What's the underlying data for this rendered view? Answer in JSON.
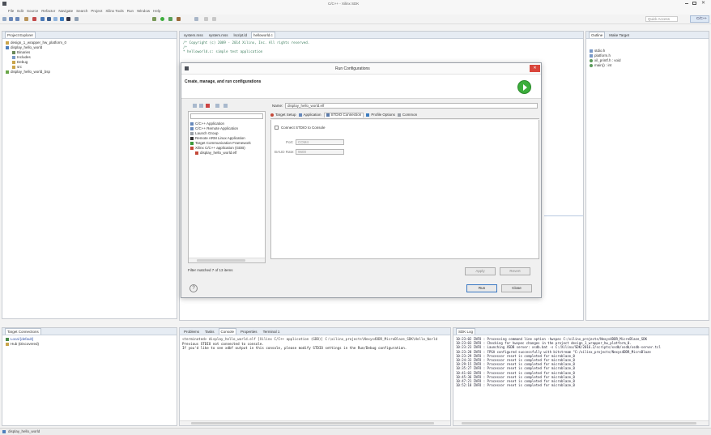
{
  "window": {
    "title": "C/C++ - Xilinx SDK"
  },
  "menu": [
    "File",
    "Edit",
    "Source",
    "Refactor",
    "Navigate",
    "Search",
    "Project",
    "Xilinx Tools",
    "Run",
    "Window",
    "Help"
  ],
  "quick_access": "Quick Access",
  "perspective_label": "C/C++",
  "project_explorer": {
    "tab": "Project Explorer",
    "items": [
      "design_1_wrapper_hw_platform_0",
      "display_hello_world",
      "Binaries",
      "Includes",
      "Debug",
      "src",
      "display_hello_world_bsp"
    ]
  },
  "editor": {
    "tabs": [
      "system.mss",
      "system.mss",
      "lscript.ld",
      "helloworld.c"
    ],
    "lines": [
      "/* Copyright (c) 2009 - 2014 Xilinx, Inc. All rights reserved.",
      "",
      "/*",
      " * helloworld.c: simple test application"
    ]
  },
  "outline": {
    "tabs": [
      "Outline",
      "Make Target"
    ],
    "items": [
      "stdio.h",
      "platform.h",
      "xil_printf.h : void",
      "main() : int"
    ]
  },
  "dialog": {
    "window_title": "Run Configurations",
    "heading": "Create, manage, and run configurations",
    "filter_placeholder": "",
    "tree": [
      "C/C++ Application",
      "C/C++ Remote Application",
      "Launch Group",
      "Remote ARM Linux Application",
      "Target Communication Framework",
      "Xilinx C/C++ application (GDB)",
      "display_hello_world.elf"
    ],
    "filter_status": "Filter matched 7 of 13 items",
    "name_label": "Name:",
    "name_value": "display_hello_world.elf",
    "tabs": [
      "Target Setup",
      "Application",
      "STDIO Connection",
      "Profile Options",
      "Common"
    ],
    "connect_label": "Connect STDIO to Console",
    "port_label": "Port:",
    "port_value": "COM4",
    "baud_label": "BAUD Rate:",
    "baud_value": "9600",
    "apply": "Apply",
    "revert": "Revert",
    "run": "Run",
    "close": "Close",
    "help_icon": "?"
  },
  "target_connections": {
    "tab": "Target Connections",
    "items": [
      "Local [default]",
      "Hub (Discovered)"
    ]
  },
  "console": {
    "tabs": [
      "Problems",
      "Tasks",
      "Console",
      "Properties",
      "Terminal 1"
    ],
    "lines": [
      "<terminated> display_hello_world.elf [Xilinx C/C++ application (GDB)] C:\\xilinx_projects\\Nexys4DDR_MicroBlaze_SDK\\Hello_World",
      "Previous STDIO not connected to console.",
      "If you'd like to see xdbf output in this console, please modify STDIO settings in the Run/Debug configuration."
    ]
  },
  "sdk_log": {
    "tab": "SDK Log",
    "lines": [
      "10:23:02 INFO : Processing command line option -hwspec C:/xilinx_projects/Nexys4DDR_MicroBlaze_SDK",
      "10:23:03 INFO : Checking for hwspec changes in the project design_1_wrapper_hw_platform_0.",
      "10:23:23 INFO : Launching XSDB server: xsdb.bat -s C:/Xilinx/SDK/2016.2/scripts/xsdb/xsdb/xsdb-server.tcl",
      "10:23:28 INFO : FPGA configured successfully with bitstream \"C:/xilinx_projects/Nexys4DDR_MicroBlaze",
      "10:23:29 INFO : Processor reset is completed for microblaze_0",
      "10:24:33 INFO : Processor reset is completed for microblaze_0",
      "10:29:15 INFO : Processor reset is completed for microblaze_0",
      "10:35:27 INFO : Processor reset is completed for microblaze_0",
      "10:41:03 INFO : Processor reset is completed for microblaze_0",
      "10:45:36 INFO : Processor reset is completed for microblaze_0",
      "10:47:21 INFO : Processor reset is completed for microblaze_0",
      "10:52:18 INFO : Processor reset is completed for microblaze_0"
    ]
  },
  "statusbar": {
    "text": "display_hello_world"
  },
  "colors": {
    "accent": "#3a78c3",
    "run_green": "#3cae3c",
    "close_red": "#d9453b"
  }
}
